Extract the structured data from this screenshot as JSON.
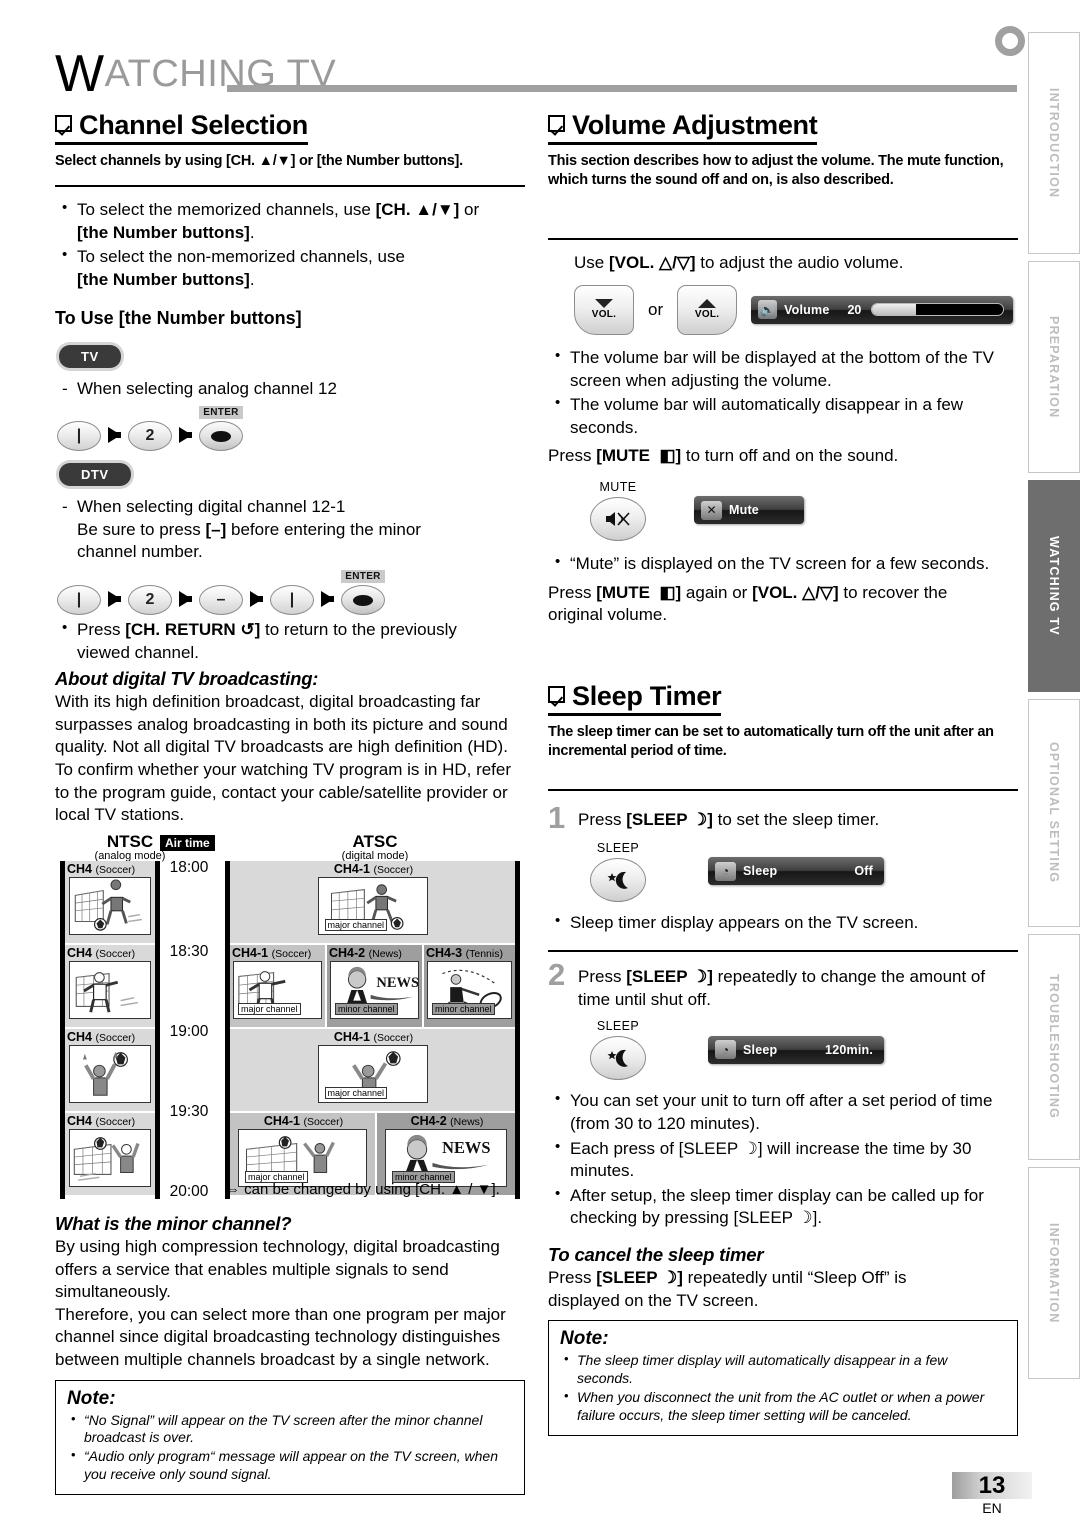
{
  "chapter": {
    "cap": "W",
    "rest": "ATCHING TV"
  },
  "side_tabs": [
    {
      "label": "INTRODUCTION",
      "active": false
    },
    {
      "label": "PREPARATION",
      "active": false
    },
    {
      "label": "WATCHING TV",
      "active": true
    },
    {
      "label": "OPTIONAL SETTING",
      "active": false
    },
    {
      "label": "TROUBLESHOOTING",
      "active": false
    },
    {
      "label": "INFORMATION",
      "active": false
    }
  ],
  "footer": {
    "page_number": "13",
    "language": "EN"
  },
  "channel_selection": {
    "heading": "Channel Selection",
    "lede": "Select channels by using [CH. ▲/▼] or [the Number buttons].",
    "bullet1_a": "To select the memorized channels, use ",
    "bullet1_b": "[CH. ▲/▼]",
    "bullet1_c": " or",
    "bullet1_d": "[the Number buttons]",
    "bullet1_e": ".",
    "bullet2_a": "To select the non-memorized channels, use",
    "bullet2_b": "[the Number buttons]",
    "bullet2_c": ".",
    "subhead_a": "To Use ",
    "subhead_b": "[the Number buttons]",
    "pill_tv": "TV",
    "pill_dtv": "DTV",
    "analog_line": "When selecting analog channel 12",
    "analog_keys": [
      "1",
      "2",
      "ENTER"
    ],
    "digital_line1": "When selecting digital channel 12-1",
    "digital_line2_a": "Be sure to press ",
    "digital_line2_b": "[–]",
    "digital_line2_c": " before entering the minor",
    "digital_line3": "channel number.",
    "digital_keys": [
      "1",
      "2",
      "–",
      "1",
      "ENTER"
    ],
    "enter_label": "ENTER",
    "return_bullet_a": "Press ",
    "return_bullet_b": "[CH. RETURN ↺]",
    "return_bullet_c": " to return to the previously",
    "return_bullet_d": "viewed channel."
  },
  "about_digital": {
    "heading": "About digital TV broadcasting:",
    "body": "With its high definition broadcast, digital broadcasting far surpasses analog broadcasting in both its picture and sound quality. Not all digital TV broadcasts are high definition (HD). To confirm whether your watching TV program is in HD, refer to the program guide, contact your cable/satellite provider or local TV stations."
  },
  "diagram": {
    "ntsc_title": "NTSC",
    "ntsc_sub": "(analog mode)",
    "atsc_title": "ATSC",
    "atsc_sub": "(digital mode)",
    "airtime_label": "Air time",
    "times": [
      "18:00",
      "18:30",
      "19:00",
      "19:30",
      "20:00"
    ],
    "major_tag": "major channel",
    "minor_tag": "minor channel",
    "ntsc_cells": [
      {
        "ch": "CH4",
        "prog": "(Soccer)"
      },
      {
        "ch": "CH4",
        "prog": "(Soccer)"
      },
      {
        "ch": "CH4",
        "prog": "(Soccer)"
      },
      {
        "ch": "CH4",
        "prog": "(Soccer)"
      }
    ],
    "atsc_rows": [
      {
        "cells": [
          {
            "ch": "CH4-1",
            "prog": "(Soccer)",
            "tag": "major channel"
          }
        ]
      },
      {
        "cells": [
          {
            "ch": "CH4-1",
            "prog": "(Soccer)",
            "tag": "major channel"
          },
          {
            "ch": "CH4-2",
            "prog": "(News)",
            "tag": "minor channel"
          },
          {
            "ch": "CH4-3",
            "prog": "(Tennis)",
            "tag": "minor channel"
          }
        ]
      },
      {
        "cells": [
          {
            "ch": "CH4-1",
            "prog": "(Soccer)",
            "tag": "major channel"
          }
        ]
      },
      {
        "cells": [
          {
            "ch": "CH4-1",
            "prog": "(Soccer)",
            "tag": "major channel"
          },
          {
            "ch": "CH4-2",
            "prog": "(News)",
            "tag": "minor channel"
          }
        ]
      }
    ],
    "footnote": "⇔ can be changed by using [CH. ▲ / ▼]."
  },
  "minor_channel": {
    "heading": "What is the minor channel?",
    "para1": "By using high compression technology, digital broadcasting offers a service that enables multiple signals to send simultaneously.",
    "para2": "Therefore, you can select more than one program per major channel since digital broadcasting technology distinguishes between multiple channels broadcast by a single network."
  },
  "note_left": {
    "title": "Note:",
    "bullets": [
      "“No Signal” will appear on the TV screen after the minor channel broadcast is over.",
      "“Audio only program“ message will appear on the TV screen, when you receive only sound signal."
    ]
  },
  "volume": {
    "heading": "Volume Adjustment",
    "lede": "This section describes how to adjust the volume. The mute function, which turns the sound off and on, is also described.",
    "use_a": "Use ",
    "use_b": "[VOL. △/▽]",
    "use_c": " to adjust the audio volume.",
    "btn_down_label": "VOL.",
    "or_label": "or",
    "btn_up_label": "VOL.",
    "osd_icon": "speaker-icon",
    "osd_label": "Volume",
    "osd_value": "20",
    "osd_fill_percent": "33",
    "bullets": [
      "The volume bar will be displayed at the bottom of the TV screen when adjusting the volume.",
      "The volume bar will automatically disappear in a few seconds."
    ],
    "mute_line_a": "Press ",
    "mute_line_b": "[MUTE  ◧]",
    "mute_line_c": " to turn off and on the sound.",
    "mute_btn_label": "MUTE",
    "mute_osd_label": "Mute",
    "mute_bullet": "“Mute” is displayed on the TV screen for a few seconds.",
    "recover_a": "Press ",
    "recover_b": "[MUTE  ◧]",
    "recover_c": " again or ",
    "recover_d": "[VOL. △/▽]",
    "recover_e": " to recover the",
    "recover_f": "original volume."
  },
  "sleep": {
    "heading": "Sleep Timer",
    "lede": "The sleep timer can be set to automatically turn off the unit after an incremental period of time.",
    "step1_num": "1",
    "step1_a": "Press ",
    "step1_b": "[SLEEP ☽]",
    "step1_c": " to set the sleep timer.",
    "btn_label": "SLEEP",
    "osd1_label": "Sleep",
    "osd1_value": "Off",
    "step1_bullet": "Sleep timer display appears on the TV screen.",
    "step2_num": "2",
    "step2_a": "Press ",
    "step2_b": "[SLEEP ☽]",
    "step2_c": " repeatedly to change the amount of",
    "step2_d": "time until shut off.",
    "osd2_label": "Sleep",
    "osd2_value": "120min.",
    "step2_bullets": [
      "You can set your unit to turn off after a set period of time (from 30 to 120 minutes).",
      "Each press of [SLEEP ☽] will increase the time by 30 minutes.",
      "After setup, the sleep timer display can be called up for checking by pressing [SLEEP ☽]."
    ],
    "cancel_heading": "To cancel the sleep timer",
    "cancel_a": "Press ",
    "cancel_b": "[SLEEP ☽]",
    "cancel_c": " repeatedly until “Sleep Off” is",
    "cancel_d": "displayed on the TV screen."
  },
  "note_right": {
    "title": "Note:",
    "bullets": [
      "The sleep timer display will automatically disappear in a few seconds.",
      "When you disconnect the unit from the AC outlet or when a power failure occurs, the sleep timer setting will be canceled."
    ]
  }
}
